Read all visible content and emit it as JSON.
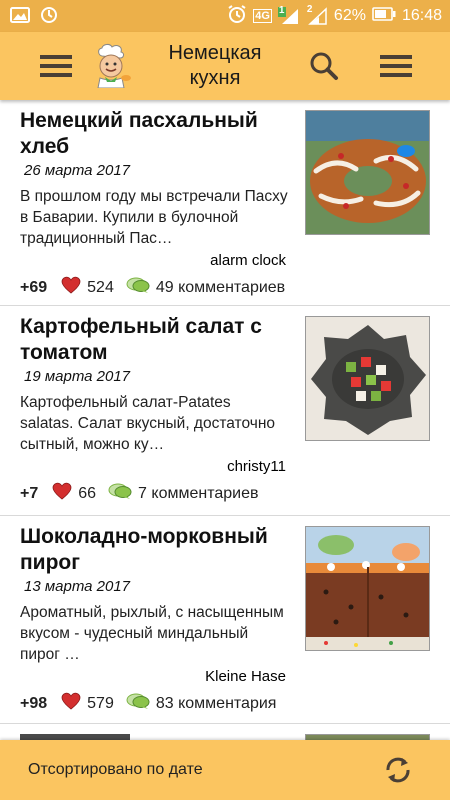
{
  "status_bar": {
    "network": "4G",
    "sim1": "1",
    "sim2": "2",
    "battery": "62%",
    "time": "16:48"
  },
  "toolbar": {
    "title": "Немецкая кухня"
  },
  "colors": {
    "primary": "#fbc560",
    "status_bar": "#ecb04a",
    "heart": "#d32f2f",
    "comment_bubble": "#8bc34a"
  },
  "recipes": [
    {
      "title": "Немецкий пасхальный хлеб",
      "date": "26 марта 2017",
      "excerpt": "В прошлом году мы встречали Пасху в Баварии. Купили в булочной традиционный Пас…",
      "author": "alarm clock",
      "votes": "+69",
      "likes": "524",
      "comments": "49 комментариев"
    },
    {
      "title": "Картофельный салат с томатом",
      "date": "19 марта 2017",
      "excerpt": "Картофельный салат-Patates salatas. Салат вкусный, достаточно сытный, можно ку…",
      "author": "christy11",
      "votes": "+7",
      "likes": "66",
      "comments": "7 комментариев"
    },
    {
      "title": "Шоколадно-морковный пирог",
      "date": "13 марта 2017",
      "excerpt": "Ароматный, рыхлый, с насыщенным вкусом - чудесный миндальный пирог …",
      "author": "Kleine Hase",
      "votes": "+98",
      "likes": "579",
      "comments": "83 комментария"
    }
  ],
  "bottom_bar": {
    "sort_label": "Отсортировано по дате"
  }
}
